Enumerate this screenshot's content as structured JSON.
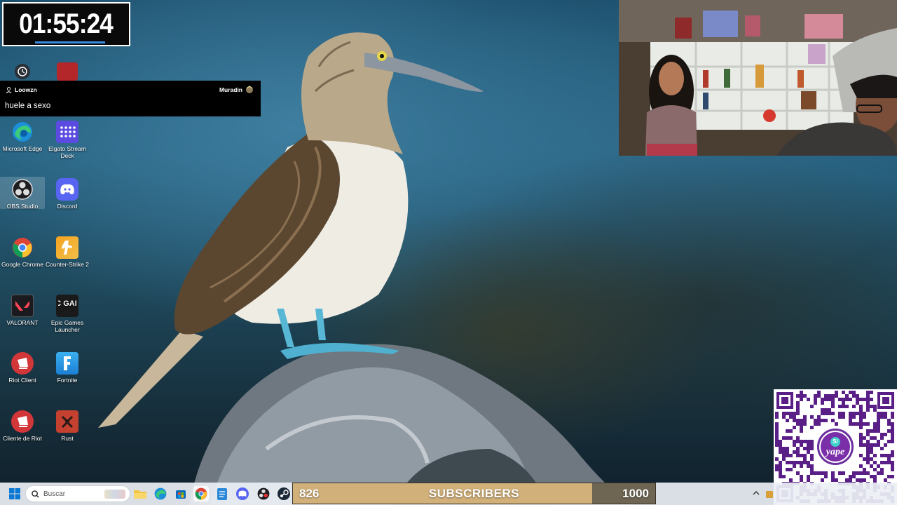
{
  "timer": {
    "text": "01:55:24"
  },
  "chat": {
    "username": "Loowzn",
    "channel": "Muradin",
    "message": "huele a sexo"
  },
  "desktop_icons": [
    {
      "label": "Microsoft Edge",
      "icon": "edge-icon"
    },
    {
      "label": "Elgato Stream Deck",
      "icon": "stream-deck-icon"
    },
    {
      "label": "OBS Studio",
      "icon": "obs-icon"
    },
    {
      "label": "Discord",
      "icon": "discord-icon"
    },
    {
      "label": "Google Chrome",
      "icon": "chrome-icon"
    },
    {
      "label": "Counter-Strike 2",
      "icon": "counter-strike-icon"
    },
    {
      "label": "VALORANT",
      "icon": "valorant-icon"
    },
    {
      "label": "Epic Games Launcher",
      "icon": "epic-games-icon",
      "logo_text": "EPIC GAMES"
    },
    {
      "label": "Riot Client",
      "icon": "riot-client-icon"
    },
    {
      "label": "Fortnite",
      "icon": "fortnite-icon"
    },
    {
      "label": "Cliente de Riot",
      "icon": "riot-client-icon"
    },
    {
      "label": "Rust",
      "icon": "rust-icon"
    }
  ],
  "taskbar": {
    "search_placeholder": "Buscar",
    "pinned": [
      "windows-start-icon",
      "file-explorer-icon",
      "edge-icon",
      "store-icon",
      "chrome-icon",
      "notepad-icon",
      "discord-icon",
      "obs-icon",
      "steam-icon"
    ]
  },
  "subscribers": {
    "current": "826",
    "label": "SUBSCRIBERS",
    "goal": "1000",
    "progress": 0.826
  },
  "qr": {
    "brand": "yape"
  },
  "colors": {
    "subbar_fill": "#d1b07a",
    "subbar_bg": "#6e6553",
    "timer_accent": "#3a8de0",
    "yape_purple": "#7a2ea8"
  }
}
